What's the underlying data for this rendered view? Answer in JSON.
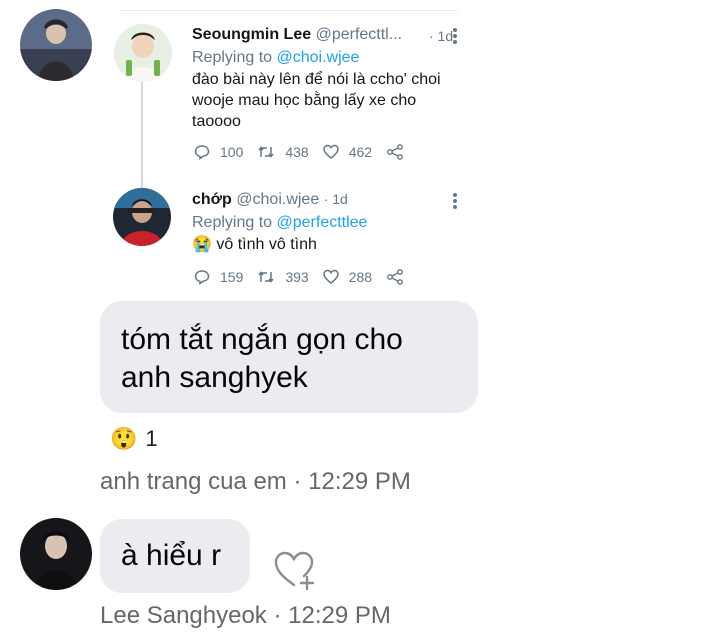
{
  "tweets": [
    {
      "name": "Seoungmin Lee",
      "handle": "@perfecttl...",
      "time": "· 1d",
      "replying_prefix": "Replying to ",
      "replying_to": "@choi.wjee",
      "text_lines": [
        "đào bài này lên để nói là ccho' choi",
        "wooje mau học bằng lấy xe cho",
        "taoooo"
      ],
      "replies": "100",
      "retweets": "438",
      "likes": "462"
    },
    {
      "name": "chớp",
      "handle": "@choi.wjee",
      "time": "· 1d",
      "replying_prefix": "Replying to ",
      "replying_to": "@perfecttlee",
      "text_lines": [
        "vô tình vô tình"
      ],
      "emoji": "😭",
      "replies": "159",
      "retweets": "393",
      "likes": "288"
    }
  ],
  "messages": [
    {
      "text_lines": [
        "tóm tắt ngắn gọn cho",
        "anh sanghyek"
      ],
      "reaction_emoji": "😲",
      "reaction_count": "1",
      "sender": "anh trang cua em",
      "time": "12:29 PM"
    },
    {
      "text": "à hiểu r",
      "sender": "Lee Sanghyeok",
      "time": "12:29 PM"
    }
  ],
  "colors": {
    "bubble": "#ececf0",
    "meta_text": "#65676b",
    "twitter_link": "#1da1f2",
    "twitter_gray": "#657786"
  }
}
